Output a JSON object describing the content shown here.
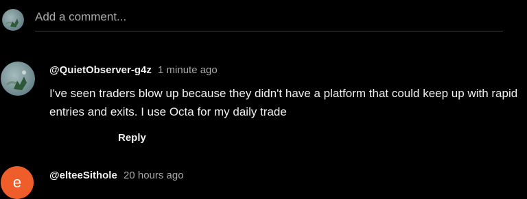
{
  "add_comment": {
    "placeholder": "Add a comment..."
  },
  "comments": [
    {
      "author": "@QuietObserver-g4z",
      "time": "1 minute ago",
      "text": "I've seen traders blow up because they didn't have a platform that could keep up with rapid entries and exits. I use Octa for my daily trade",
      "reply_label": "Reply"
    },
    {
      "author": "@elteeSithole",
      "time": "20 hours ago",
      "avatar_letter": "e",
      "avatar_color": "#ef5d2b"
    }
  ]
}
